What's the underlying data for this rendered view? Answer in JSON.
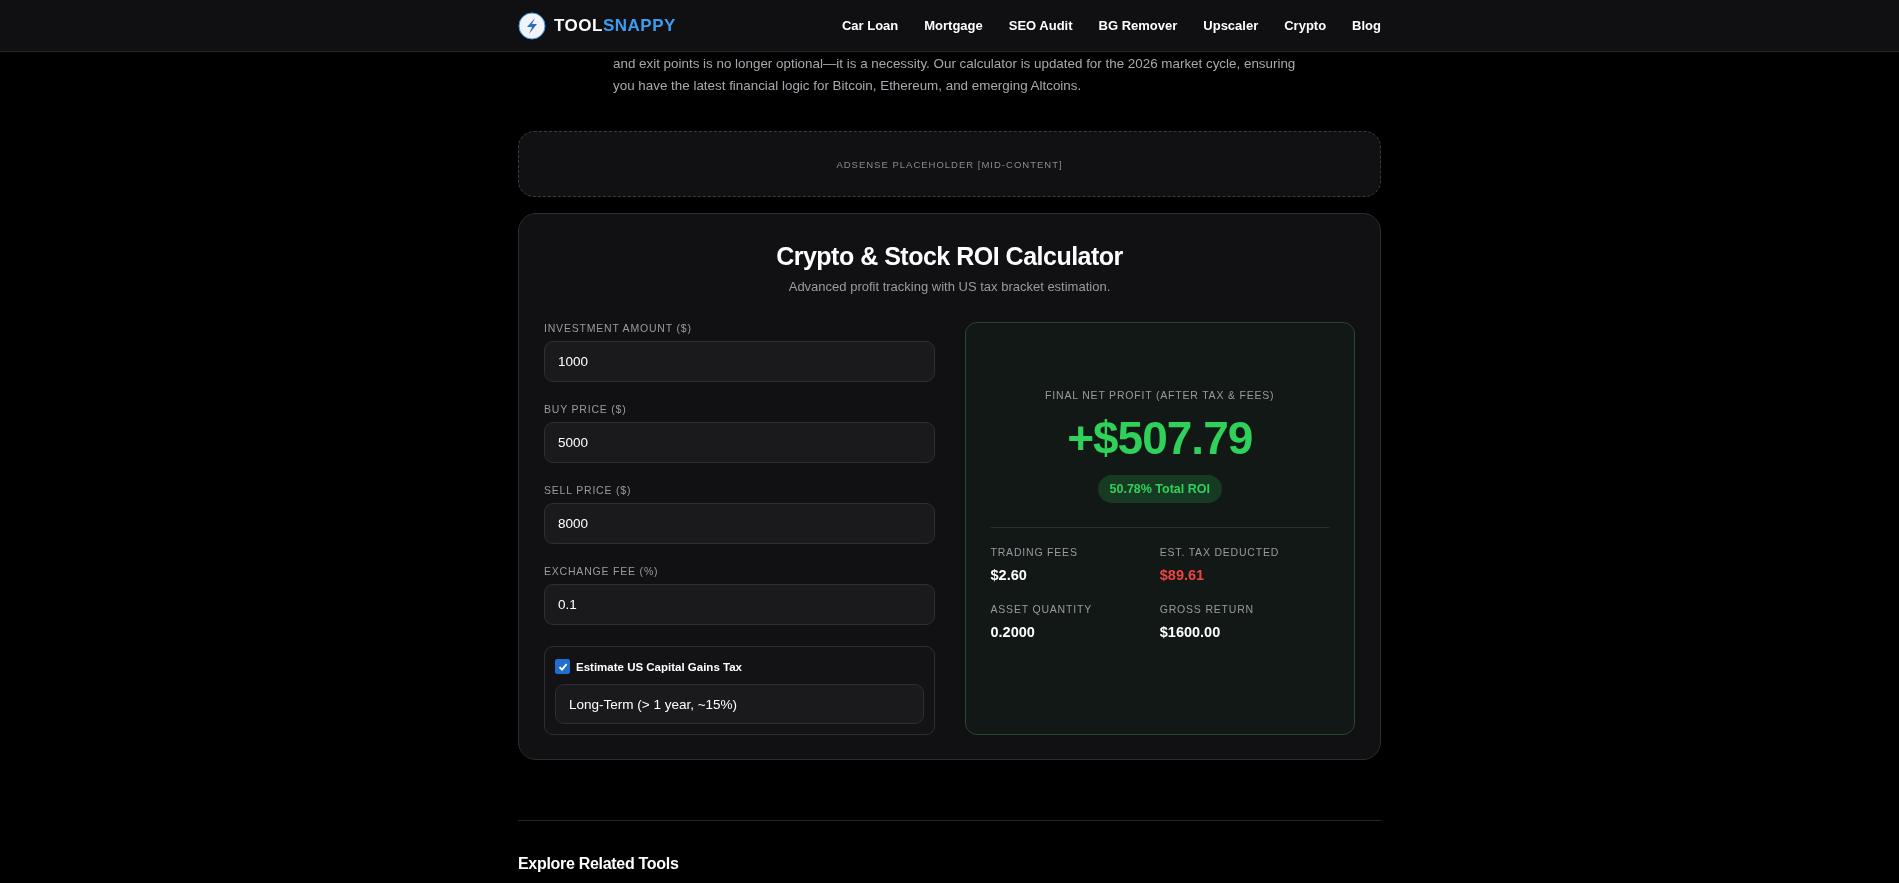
{
  "header": {
    "logo": {
      "word_main": "TOOL",
      "word_accent": "SNAPPY"
    },
    "nav": [
      {
        "label": "Car Loan"
      },
      {
        "label": "Mortgage"
      },
      {
        "label": "SEO Audit"
      },
      {
        "label": "BG Remover"
      },
      {
        "label": "Upscaler"
      },
      {
        "label": "Crypto"
      },
      {
        "label": "Blog"
      }
    ]
  },
  "intro": {
    "text": "and exit points is no longer optional—it is a necessity. Our calculator is updated for the 2026 market cycle, ensuring\nyou have the latest financial logic for Bitcoin, Ethereum, and emerging Altcoins."
  },
  "ad": {
    "label": "ADSENSE PLACEHOLDER [MID-CONTENT]"
  },
  "calculator": {
    "title": "Crypto & Stock ROI Calculator",
    "subtitle": "Advanced profit tracking with US tax bracket estimation.",
    "fields": [
      {
        "label": "INVESTMENT AMOUNT ($)",
        "value": "1000"
      },
      {
        "label": "BUY PRICE ($)",
        "value": "5000"
      },
      {
        "label": "SELL PRICE ($)",
        "value": "8000"
      },
      {
        "label": "EXCHANGE FEE (%)",
        "value": "0.1"
      }
    ],
    "tax": {
      "label": "Estimate US Capital Gains Tax",
      "checked": true,
      "select": "Long-Term (> 1 year, ~15%)"
    },
    "result": {
      "label": "FINAL NET PROFIT (AFTER TAX & FEES)",
      "value": "+$507.79",
      "roi": "50.78% Total ROI",
      "stats": [
        {
          "label": "TRADING FEES",
          "value": "$2.60",
          "kind": "plain"
        },
        {
          "label": "EST. TAX DEDUCTED",
          "value": "$89.61",
          "kind": "loss"
        },
        {
          "label": "ASSET QUANTITY",
          "value": "0.2000",
          "kind": "plain"
        },
        {
          "label": "GROSS RETURN",
          "value": "$1600.00",
          "kind": "plain"
        }
      ]
    }
  },
  "related": {
    "title": "Explore Related Tools"
  }
}
